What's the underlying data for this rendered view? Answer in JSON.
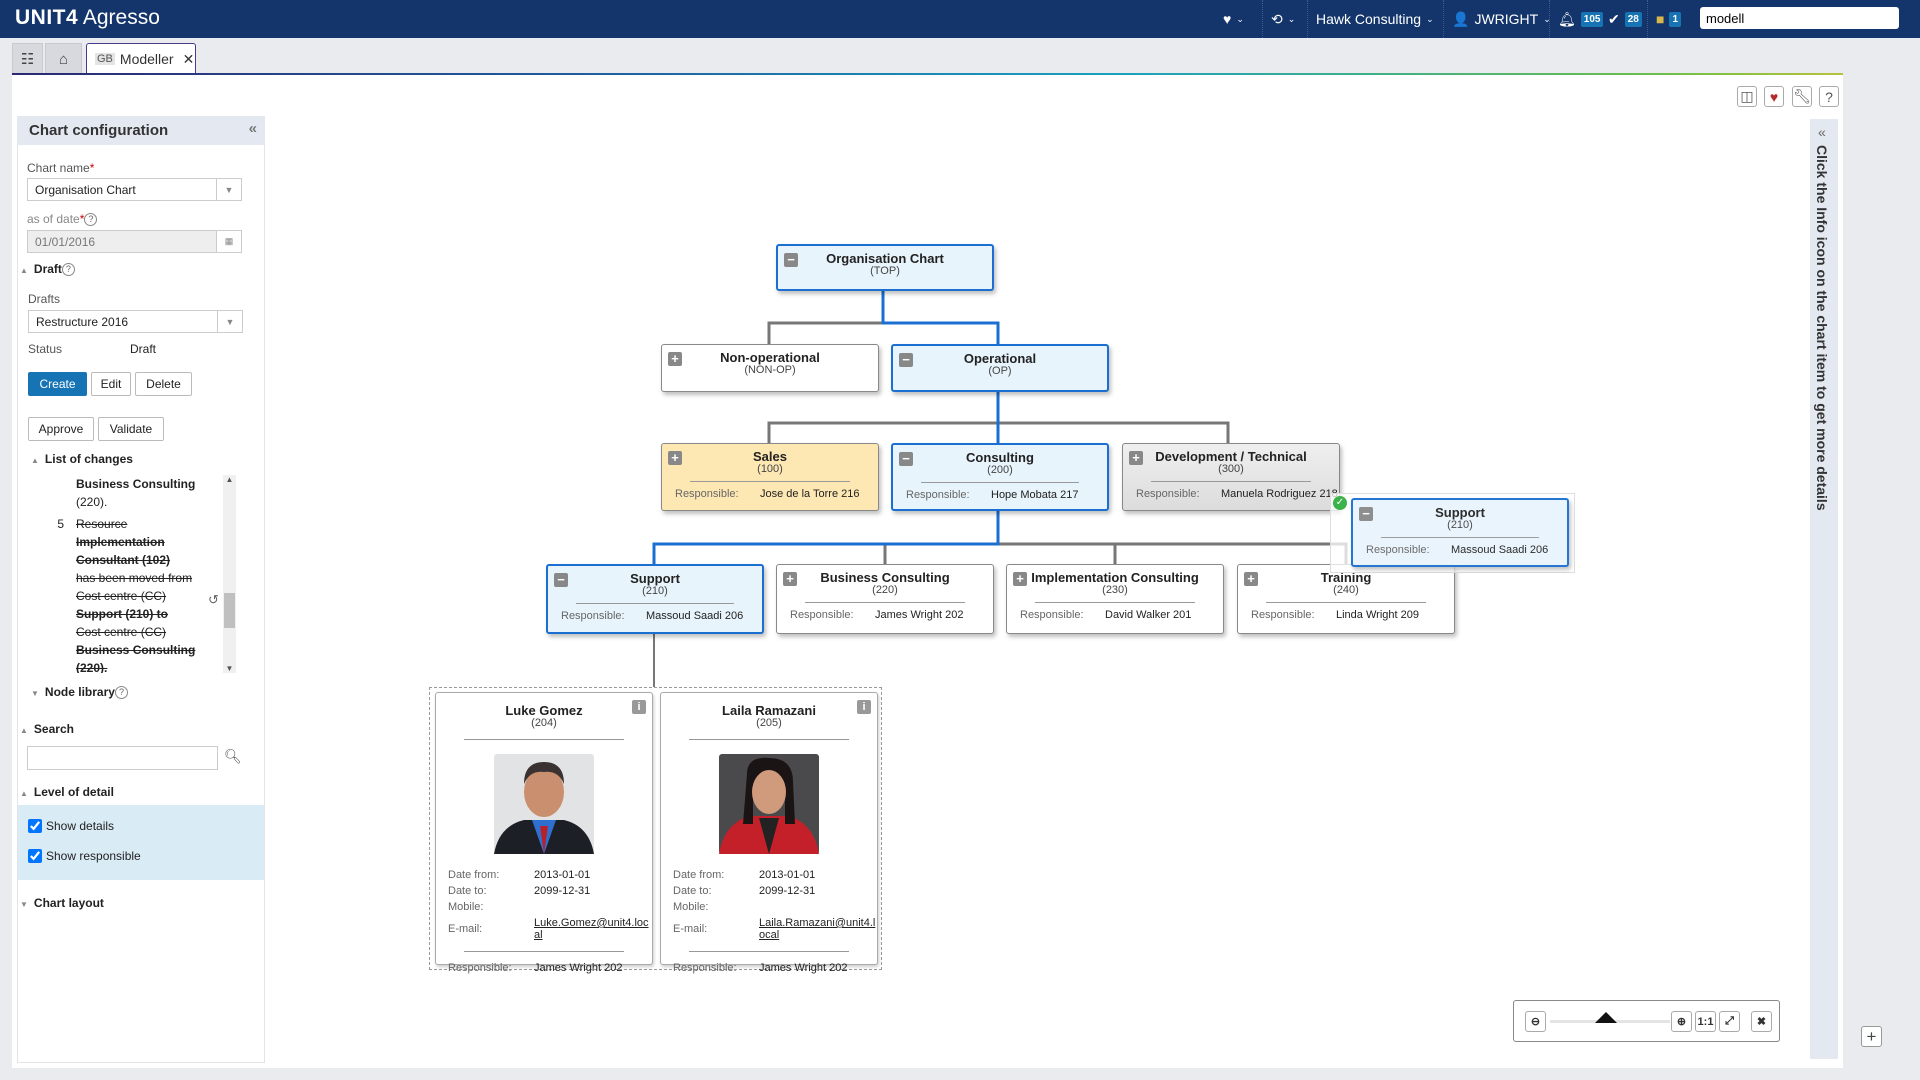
{
  "app": {
    "brand": "UNIT4",
    "product": "Agresso"
  },
  "topbar": {
    "company": "Hawk Consulting",
    "user": "JWRIGHT",
    "notifications": "105",
    "tasks": "28",
    "messages": "1",
    "search_value": "modell"
  },
  "tabs": {
    "active_prefix": "GB",
    "active_label": "Modeller"
  },
  "right_panel": {
    "hint": "Click the Info icon on the chart item to get more details"
  },
  "config": {
    "title": "Chart configuration",
    "chart_name_label": "Chart name",
    "chart_name_value": "Organisation Chart",
    "as_of_date_label": "as of date",
    "as_of_date_value": "01/01/2016",
    "draft_section": "Draft",
    "drafts_label": "Drafts",
    "drafts_value": "Restructure 2016",
    "status_label": "Status",
    "status_value": "Draft",
    "buttons": {
      "create": "Create",
      "edit": "Edit",
      "delete": "Delete",
      "approve": "Approve",
      "validate": "Validate"
    },
    "changes_section": "List of changes",
    "changes": {
      "prev_tail_1": "Business Consulting",
      "prev_tail_2": "(220).",
      "item5_num": "5",
      "item5": [
        "Resource",
        "Implementation",
        "Consultant (102)",
        "has been moved from",
        "Cost centre (CC)",
        "Support (210) to",
        "Cost centre (CC)",
        "Business Consulting",
        "(220)."
      ]
    },
    "node_library": "Node library",
    "search_section": "Search",
    "search_value": "",
    "level_section": "Level of detail",
    "show_details": "Show details",
    "show_responsible": "Show responsible",
    "show_details_checked": true,
    "show_responsible_checked": true,
    "layout_section": "Chart layout"
  },
  "chart": {
    "responsible_label": "Responsible:",
    "nodes": [
      {
        "title": "Organisation Chart",
        "code": "(TOP)"
      },
      {
        "title": "Non-operational",
        "code": "(NON-OP)"
      },
      {
        "title": "Operational",
        "code": "(OP)"
      },
      {
        "title": "Sales",
        "code": "(100)",
        "responsible": "Jose de la Torre 216"
      },
      {
        "title": "Consulting",
        "code": "(200)",
        "responsible": "Hope Mobata 217"
      },
      {
        "title": "Development / Technical",
        "code": "(300)",
        "responsible": "Manuela Rodriguez 218"
      },
      {
        "title": "Support",
        "code": "(210)",
        "responsible": "Massoud Saadi 206"
      },
      {
        "title": "Business Consulting",
        "code": "(220)",
        "responsible": "James Wright 202"
      },
      {
        "title": "Implementation Consulting",
        "code": "(230)",
        "responsible": "David Walker 201"
      },
      {
        "title": "Training",
        "code": "(240)",
        "responsible": "Linda Wright 209"
      },
      {
        "title": "Support",
        "code": "(210)",
        "responsible": "Massoud Saadi 206"
      }
    ],
    "people_labels": {
      "date_from": "Date from:",
      "date_to": "Date to:",
      "mobile": "Mobile:",
      "email": "E-mail:",
      "responsible": "Responsible:"
    },
    "people": [
      {
        "name": "Luke Gomez",
        "code": "(204)",
        "date_from": "2013-01-01",
        "date_to": "2099-12-31",
        "mobile": "",
        "email": "Luke.Gomez@unit4.local",
        "responsible": "James Wright 202"
      },
      {
        "name": "Laila Ramazani",
        "code": "(205)",
        "date_from": "2013-01-01",
        "date_to": "2099-12-31",
        "mobile": "",
        "email": "Laila.Ramazani@unit4.local",
        "responsible": "James Wright 202"
      }
    ],
    "zoom": {
      "one_to_one": "1:1"
    }
  },
  "colors": {
    "header": "#13356b",
    "accent": "#1774b4",
    "selected_border": "#1a6fd0",
    "sales_fill": "#fde8b4"
  }
}
